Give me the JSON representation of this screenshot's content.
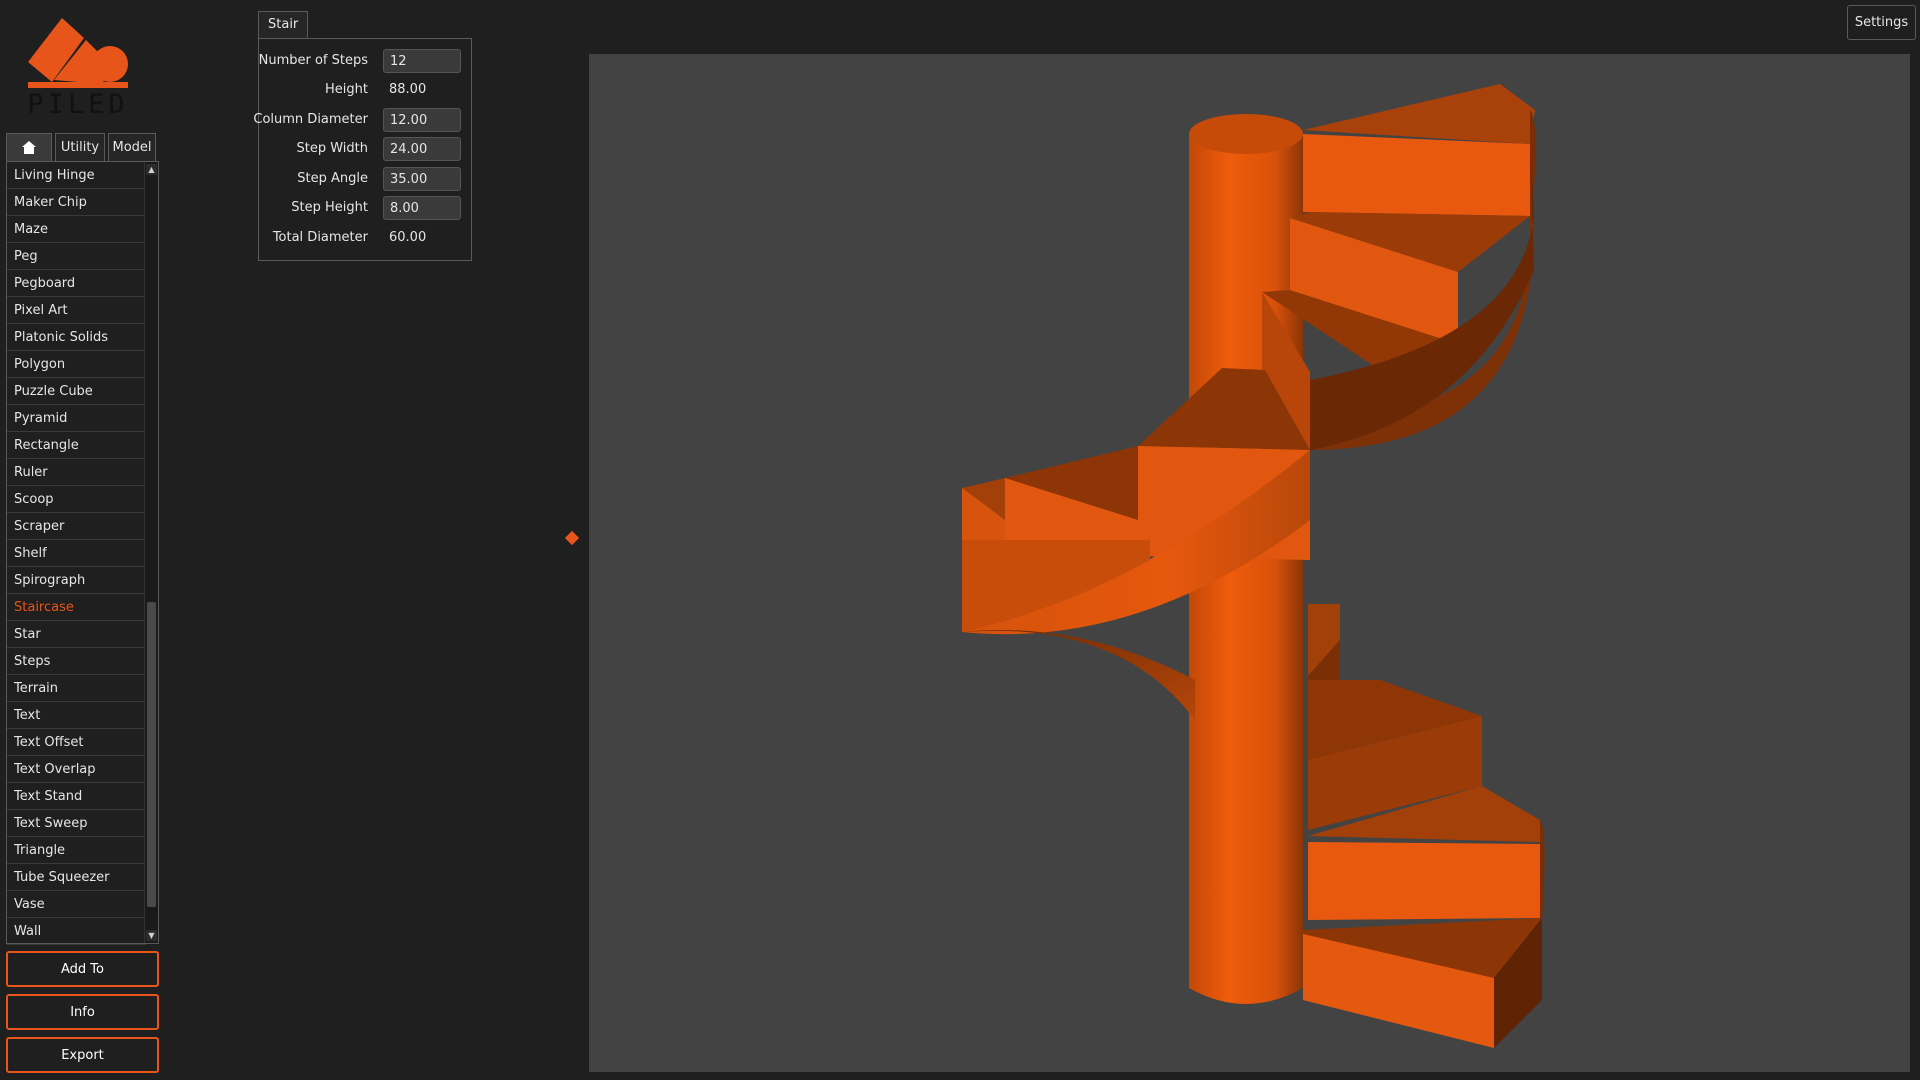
{
  "brand": {
    "logo_text": "PILED",
    "accent_color": "#e8551a"
  },
  "tabs": [
    {
      "icon": "home-icon",
      "label": "",
      "active": true
    },
    {
      "label": "Utility",
      "active": false
    },
    {
      "label": "Model",
      "active": false
    }
  ],
  "model_list": {
    "selected": "Staircase",
    "items": [
      {
        "label": "Living Hinge"
      },
      {
        "label": "Maker Chip"
      },
      {
        "label": "Maze"
      },
      {
        "label": "Peg"
      },
      {
        "label": "Pegboard"
      },
      {
        "label": "Pixel Art"
      },
      {
        "label": "Platonic Solids"
      },
      {
        "label": "Polygon"
      },
      {
        "label": "Puzzle Cube"
      },
      {
        "label": "Pyramid"
      },
      {
        "label": "Rectangle"
      },
      {
        "label": "Ruler"
      },
      {
        "label": "Scoop"
      },
      {
        "label": "Scraper"
      },
      {
        "label": "Shelf"
      },
      {
        "label": "Spirograph"
      },
      {
        "label": "Staircase"
      },
      {
        "label": "Star"
      },
      {
        "label": "Steps"
      },
      {
        "label": "Terrain"
      },
      {
        "label": "Text"
      },
      {
        "label": "Text Offset"
      },
      {
        "label": "Text Overlap"
      },
      {
        "label": "Text Stand"
      },
      {
        "label": "Text Sweep"
      },
      {
        "label": "Triangle"
      },
      {
        "label": "Tube Squeezer"
      },
      {
        "label": "Vase"
      },
      {
        "label": "Wall"
      }
    ]
  },
  "actions": {
    "add_to": "Add To",
    "info": "Info",
    "export": "Export"
  },
  "params": {
    "tab_label": "Stair",
    "number_of_steps": {
      "label": "Number of Steps",
      "value": "12"
    },
    "height": {
      "label": "Height",
      "value": "88.00"
    },
    "column_diameter": {
      "label": "Column Diameter",
      "value": "12.00"
    },
    "step_width": {
      "label": "Step Width",
      "value": "24.00"
    },
    "step_angle": {
      "label": "Step Angle",
      "value": "35.00"
    },
    "step_height": {
      "label": "Step Height",
      "value": "8.00"
    },
    "total_diameter": {
      "label": "Total Diameter",
      "value": "60.00"
    }
  },
  "header": {
    "settings_label": "Settings"
  },
  "viewport": {
    "background_color": "#434343",
    "model_color": "#e8580f"
  }
}
